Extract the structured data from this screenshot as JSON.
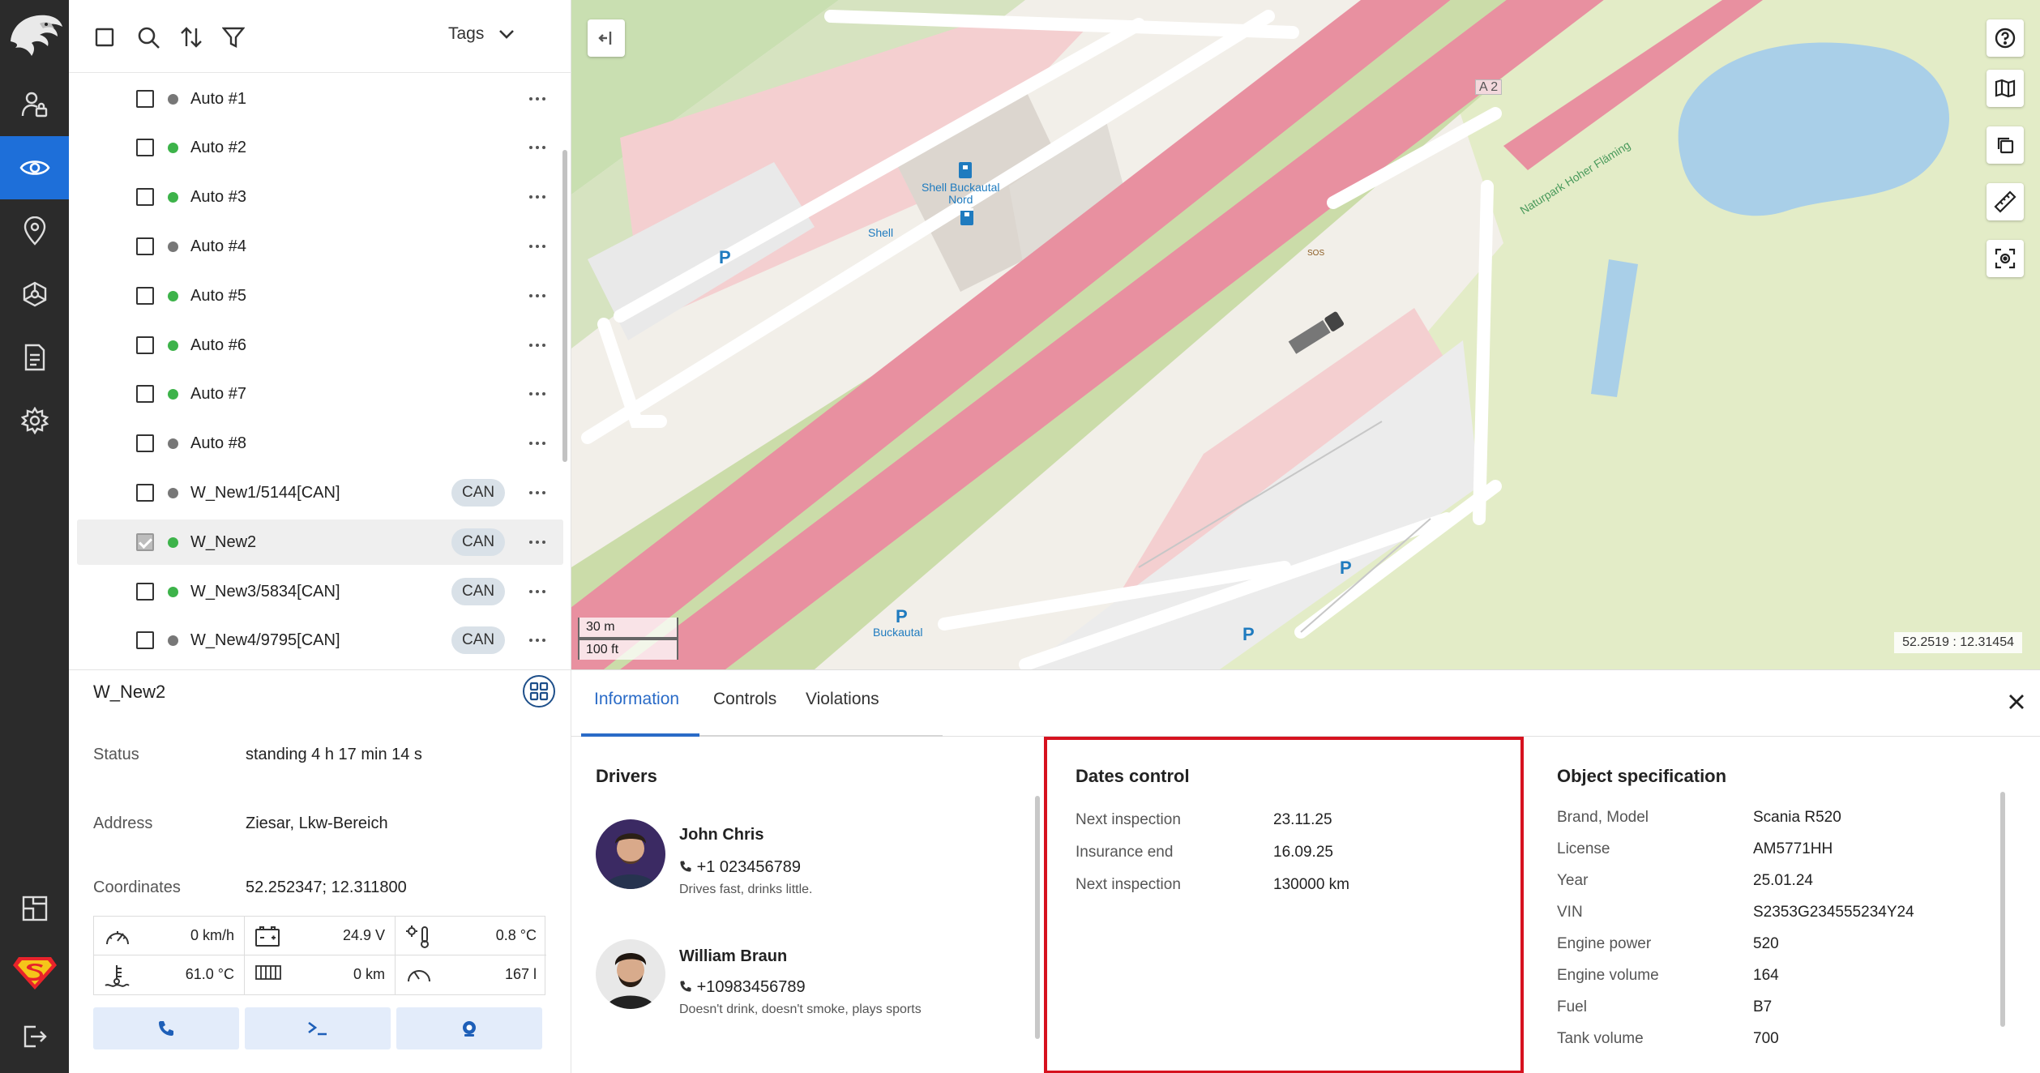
{
  "toolbar": {
    "tags_label": "Tags"
  },
  "objects": [
    {
      "name": "Auto #1",
      "status_color": "#777777",
      "can": "",
      "checked": false
    },
    {
      "name": "Auto #2",
      "status_color": "#3db34a",
      "can": "",
      "checked": false
    },
    {
      "name": "Auto #3",
      "status_color": "#3db34a",
      "can": "",
      "checked": false
    },
    {
      "name": "Auto #4",
      "status_color": "#777777",
      "can": "",
      "checked": false
    },
    {
      "name": "Auto #5",
      "status_color": "#3db34a",
      "can": "",
      "checked": false
    },
    {
      "name": "Auto #6",
      "status_color": "#3db34a",
      "can": "",
      "checked": false
    },
    {
      "name": "Auto #7",
      "status_color": "#3db34a",
      "can": "",
      "checked": false
    },
    {
      "name": "Auto #8",
      "status_color": "#777777",
      "can": "",
      "checked": false
    },
    {
      "name": "W_New1/5144[CAN]",
      "status_color": "#777777",
      "can": "CAN",
      "checked": false
    },
    {
      "name": "W_New2",
      "status_color": "#3db34a",
      "can": "CAN",
      "checked": true
    },
    {
      "name": "W_New3/5834[CAN]",
      "status_color": "#3db34a",
      "can": "CAN",
      "checked": false
    },
    {
      "name": "W_New4/9795[CAN]",
      "status_color": "#777777",
      "can": "CAN",
      "checked": false
    }
  ],
  "details": {
    "title": "W_New2",
    "status_label": "Status",
    "status_value": "standing 4 h 17 min 14 s",
    "address_label": "Address",
    "address_value": "Ziesar, Lkw-Bereich",
    "coords_label": "Coordinates",
    "coords_value": "52.252347; 12.311800",
    "sensors": {
      "speed": "0 km/h",
      "voltage": "24.9 V",
      "temperature": "0.8 °C",
      "coolant": "61.0 °C",
      "mileage": "0 km",
      "fuel": "167 l"
    }
  },
  "map": {
    "scale_m": "30 m",
    "scale_ft": "100 ft",
    "cursor_coords": "52.2519 : 12.31454",
    "labels": {
      "shell": "Shell",
      "shell_buckautal_1": "Shell Buckautal",
      "shell_buckautal_2": "Nord",
      "buckautal": "Buckautal",
      "naturpark": "Naturpark Hoher Fläming",
      "road": "A 2",
      "sos": "SOS",
      "parking": "P"
    }
  },
  "tabs": [
    "Information",
    "Controls",
    "Violations"
  ],
  "drivers": {
    "title": "Drivers",
    "list": [
      {
        "name": "John Chris",
        "phone": "+1 023456789",
        "note": "Drives fast, drinks little."
      },
      {
        "name": "William Braun",
        "phone": "+10983456789",
        "note": "Doesn't drink, doesn't smoke, plays sports"
      }
    ]
  },
  "dates_control": {
    "title": "Dates control",
    "items": [
      {
        "label": "Next inspection",
        "value": "23.11.25"
      },
      {
        "label": "Insurance end",
        "value": "16.09.25"
      },
      {
        "label": "Next inspection",
        "value": "130000 km"
      }
    ]
  },
  "specification": {
    "title": "Object specification",
    "items": [
      {
        "label": "Brand, Model",
        "value": "Scania R520"
      },
      {
        "label": "License",
        "value": "AM5771HH"
      },
      {
        "label": "Year",
        "value": "25.01.24"
      },
      {
        "label": "VIN",
        "value": "S2353G234555234Y24"
      },
      {
        "label": "Engine power",
        "value": "520"
      },
      {
        "label": "Engine volume",
        "value": "164"
      },
      {
        "label": "Fuel",
        "value": "B7"
      },
      {
        "label": "Tank volume",
        "value": "700"
      }
    ]
  },
  "colors": {
    "accent": "#1e6fd9",
    "highlight_box": "#d6121f",
    "road_motorway": "#e8899e"
  }
}
